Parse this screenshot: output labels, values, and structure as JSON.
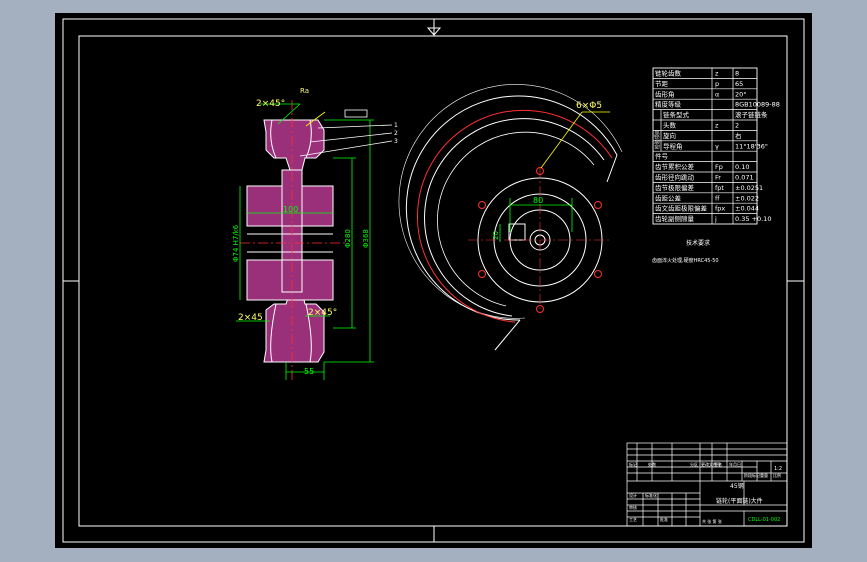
{
  "colors": {
    "background": "#a4afc0",
    "sheet": "#000000",
    "frame": "#ffffff",
    "dimension": "#00ff00",
    "leader": "#ffff00",
    "section_fill": "#9a2f7a",
    "pitch_circle": "#ff3030",
    "title_text": "#00ff00"
  },
  "side_view": {
    "chamfer_top": "2×45°",
    "chamfer_bottom_left": "2×45",
    "chamfer_bottom_right": "2×45°",
    "surface_mark": "Ra",
    "width_dim": "100",
    "bore_dim": "Φ74 H7/k6",
    "dia_inner": "Φ280",
    "dia_outer": "Φ368",
    "hub_dim": "55",
    "leader_numbers": [
      "1",
      "2",
      "3"
    ]
  },
  "front_view": {
    "holes_label": "6×Φ5",
    "hub_dim_x": "80",
    "hub_dim_y": "20"
  },
  "param_table": {
    "side_label": "检验项目",
    "rows": [
      {
        "name": "链轮齿数",
        "sym": "z",
        "val": "8"
      },
      {
        "name": "节距",
        "sym": "p",
        "val": "65"
      },
      {
        "name": "齿形角",
        "sym": "α",
        "val": "20°"
      },
      {
        "name": "精度等级",
        "sym": "",
        "val": "8GB10089-88"
      },
      {
        "name": "链条型式",
        "sym": "",
        "val": "滚子链链条"
      },
      {
        "name": "头数",
        "sym": "z",
        "val": "2"
      },
      {
        "name": "旋向",
        "sym": "",
        "val": "右"
      },
      {
        "name": "导程角",
        "sym": "γ",
        "val": "11°18'36\""
      },
      {
        "name": "件号",
        "sym": "",
        "val": ""
      },
      {
        "name": "齿节累积公差",
        "sym": "Fp",
        "val": "0.10"
      },
      {
        "name": "齿形径向跳动",
        "sym": "Fr",
        "val": "0.071"
      },
      {
        "name": "齿节极限偏差",
        "sym": "fpt",
        "val": "±0.0251"
      },
      {
        "name": "齿距公差",
        "sym": "ff",
        "val": "±0.022"
      },
      {
        "name": "齿文齿距极限偏差",
        "sym": "fpx",
        "val": "±0.044"
      },
      {
        "name": "齿轮副侧隙量",
        "sym": "j",
        "val": "0.35 +0.10"
      }
    ]
  },
  "tech_notes": {
    "title": "技术要求",
    "line1": "齿面淬火处理,硬度HRC45-50"
  },
  "title_block": {
    "small_labels": [
      "标记",
      "处数",
      "分区",
      "更改文件号",
      "签名",
      "年月日"
    ],
    "col_labels": [
      "设计",
      "标准化",
      "审核",
      "工艺",
      "批准"
    ],
    "stage_labels": [
      "阶段标记",
      "重量",
      "比例"
    ],
    "scale": "1:2",
    "material": "45钢",
    "part_name": "链轮(平面链)大件",
    "drawing_no": "CDLL-01-002",
    "sheet_info": "共 张 第 张"
  }
}
